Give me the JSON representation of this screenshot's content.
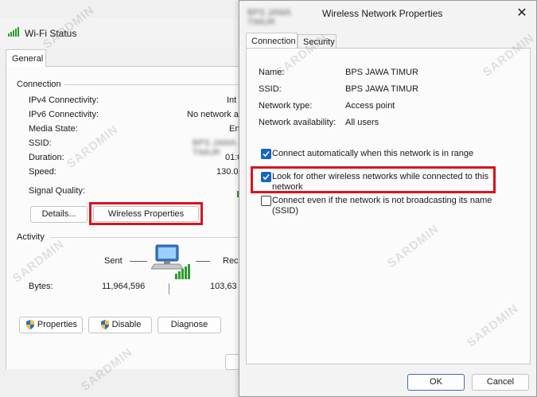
{
  "wifi_status": {
    "title": "Wi-Fi Status",
    "tab": "General",
    "connection_group": "Connection",
    "rows": [
      {
        "label": "IPv4 Connectivity:",
        "value": "Int"
      },
      {
        "label": "IPv6 Connectivity:",
        "value": "No network a"
      },
      {
        "label": "Media State:",
        "value": "En"
      },
      {
        "label": "SSID:",
        "value": "BPS JAWA TIMUR"
      },
      {
        "label": "Duration:",
        "value": "01:0"
      },
      {
        "label": "Speed:",
        "value": "130.0"
      }
    ],
    "signal_quality_label": "Signal Quality:",
    "details_button": "Details...",
    "wireless_properties_button": "Wireless Properties",
    "activity_group": "Activity",
    "sent_label": "Sent",
    "received_label": "Rec",
    "bytes_label": "Bytes:",
    "bytes_sent": "11,964,596",
    "bytes_received": "103,63",
    "properties_button": "Properties",
    "disable_button": "Disable",
    "diagnose_button": "Diagnose",
    "icons": [
      "wifi-signal-icon",
      "network-computer-icon",
      "uac-shield-icon"
    ]
  },
  "wireless_props": {
    "title": "Wireless Network Properties",
    "title_prefix_blurred": "BPS JAWA TIMUR",
    "close_glyph": "✕",
    "tabs": [
      "Connection",
      "Security"
    ],
    "fields": [
      {
        "label": "Name:",
        "value": "BPS JAWA TIMUR"
      },
      {
        "label": "SSID:",
        "value": "BPS JAWA TIMUR"
      },
      {
        "label": "Network type:",
        "value": "Access point"
      },
      {
        "label": "Network availability:",
        "value": "All users"
      }
    ],
    "options": [
      {
        "line1": "Connect automatically when this network is in range",
        "line2": "",
        "checked": true
      },
      {
        "line1": "Look for other wireless networks while connected to this",
        "line2": "network",
        "checked": true
      },
      {
        "line1": "Connect even if the network is not broadcasting its name",
        "line2": "(SSID)",
        "checked": false
      }
    ],
    "ok_button": "OK",
    "cancel_button": "Cancel"
  },
  "watermark": "SARDMIN",
  "colors": {
    "highlight": "#d8141e",
    "checkbox": "#1566c0",
    "signal": "#2e9a2e"
  }
}
